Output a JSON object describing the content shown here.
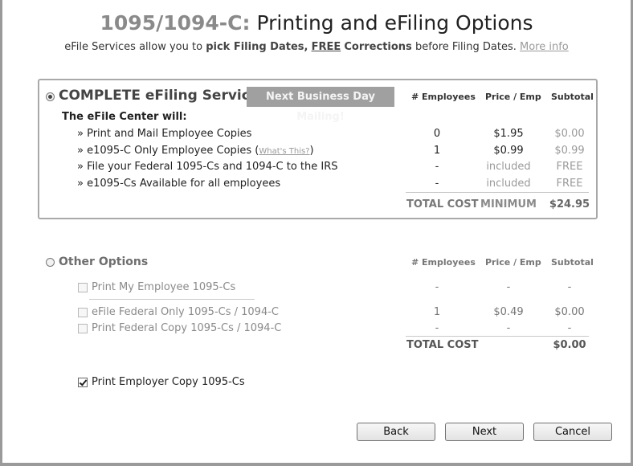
{
  "header": {
    "title_prefix": "1095/1094-C:",
    "title_main": "Printing and eFiling Options",
    "subtitle_part1": "eFile Services allow you to",
    "subtitle_pick": "pick Filing Dates,",
    "subtitle_free": "FREE",
    "subtitle_corrections": "Corrections",
    "subtitle_part2": "before Filing Dates.",
    "more_info": "More info"
  },
  "complete": {
    "title": "COMPLETE eFiling Service",
    "selected": true,
    "badge": "Next Business Day Mailing!",
    "center_label": "The eFile Center will:",
    "col_employees": "# Employees",
    "col_price": "Price / Emp",
    "col_subtotal": "Subtotal",
    "items": [
      {
        "label": "» Print and Mail Employee Copies",
        "link": "",
        "employees": "0",
        "price": "$1.95",
        "subtotal": "$0.00"
      },
      {
        "label": "» e1095-C Only Employee Copies (",
        "link": "What's This?",
        "employees": "1",
        "price": "$0.99",
        "subtotal": "$0.99"
      },
      {
        "label": "» File your Federal 1095-Cs and 1094-C to the IRS",
        "link": "",
        "employees": "-",
        "price": "included",
        "subtotal": "FREE"
      },
      {
        "label": "» e1095-Cs Available for all employees",
        "link": "",
        "employees": "-",
        "price": "included",
        "subtotal": "FREE"
      }
    ],
    "total_label": "TOTAL COST",
    "total_minimum": "MINIMUM",
    "total_value": "$24.95"
  },
  "other": {
    "title": "Other Options",
    "selected": false,
    "col_employees": "# Employees",
    "col_price": "Price / Emp",
    "col_subtotal": "Subtotal",
    "items": [
      {
        "label": "Print My Employee 1095-Cs",
        "employees": "-",
        "price": "-",
        "subtotal": "-"
      },
      {
        "label": "eFile Federal Only 1095-Cs / 1094-C",
        "employees": "1",
        "price": "$0.49",
        "subtotal": "$0.00"
      },
      {
        "label": "Print Federal Copy 1095-Cs / 1094-C",
        "employees": "-",
        "price": "-",
        "subtotal": "-"
      }
    ],
    "total_label": "TOTAL COST",
    "total_value": "$0.00"
  },
  "employer_copy": {
    "label": "Print Employer Copy 1095-Cs",
    "checked": true
  },
  "buttons": {
    "back": "Back",
    "next": "Next",
    "cancel": "Cancel"
  }
}
